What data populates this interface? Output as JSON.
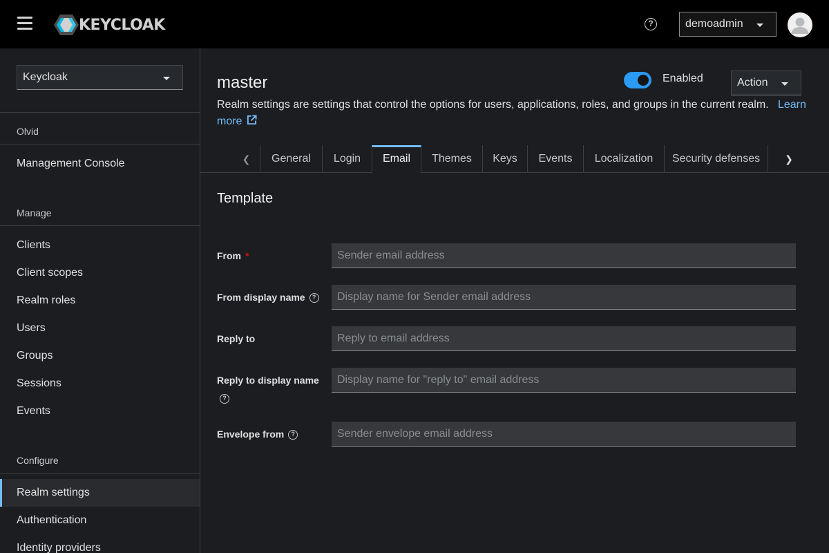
{
  "header": {
    "logo_text": "KEYCLOAK",
    "help_icon": "?",
    "user_name": "demoadmin"
  },
  "sidebar": {
    "realm_select": "Keycloak",
    "sections": {
      "olvid": "Olvid",
      "manage": "Manage",
      "configure": "Configure"
    },
    "management_console": "Management Console",
    "manage_items": [
      "Clients",
      "Client scopes",
      "Realm roles",
      "Users",
      "Groups",
      "Sessions",
      "Events"
    ],
    "configure_items": [
      "Realm settings",
      "Authentication",
      "Identity providers"
    ],
    "active_item": "Realm settings"
  },
  "main": {
    "realm_title": "master",
    "enabled_label": "Enabled",
    "enabled": true,
    "action_label": "Action",
    "description": "Realm settings are settings that control the options for users, applications, roles, and groups in the current realm.",
    "learn_more": "Learn more",
    "tabs": [
      "General",
      "Login",
      "Email",
      "Themes",
      "Keys",
      "Events",
      "Localization",
      "Security defenses"
    ],
    "active_tab": "Email",
    "section_title": "Template",
    "form": {
      "from_label": "From",
      "from_required": "*",
      "from_placeholder": "Sender email address",
      "from_display_label": "From display name",
      "from_display_placeholder": "Display name for Sender email address",
      "reply_to_label": "Reply to",
      "reply_to_placeholder": "Reply to email address",
      "reply_to_display_label": "Reply to display name",
      "reply_to_display_placeholder": "Display name for \"reply to\" email address",
      "envelope_from_label": "Envelope from",
      "envelope_from_placeholder": "Sender envelope email address"
    }
  },
  "colors": {
    "accent": "#73bcf7",
    "toggle_on": "#2b9af3",
    "required": "#c9190b"
  }
}
